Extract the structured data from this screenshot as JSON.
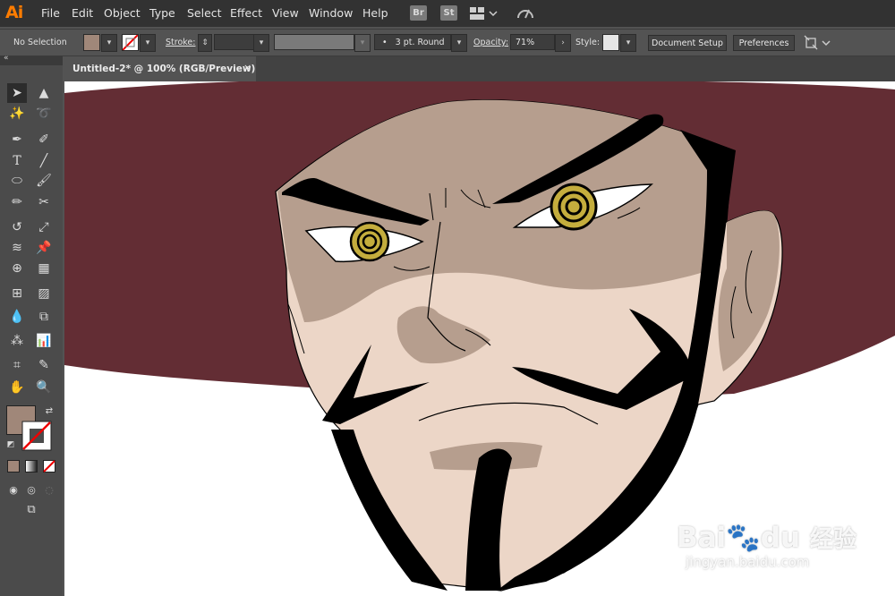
{
  "app": {
    "logo": "Ai"
  },
  "menu": {
    "items": [
      "File",
      "Edit",
      "Object",
      "Type",
      "Select",
      "Effect",
      "View",
      "Window",
      "Help"
    ]
  },
  "menubar_icons": {
    "bridge": "Br",
    "stock": "St"
  },
  "options_bar": {
    "selection_status": "No Selection",
    "fill_color": "#a08779",
    "stroke_label": "Stroke:",
    "brush_label": "3 pt. Round",
    "opacity_label": "Opacity:",
    "opacity_value": "71%",
    "style_label": "Style:",
    "document_setup_label": "Document Setup",
    "preferences_label": "Preferences"
  },
  "document_tab": {
    "title": "Untitled-2* @ 100% (RGB/Preview)",
    "close": "×"
  },
  "tools_panel": {
    "collapse_glyph": "«",
    "fill_color": "#a08779"
  },
  "canvas": {
    "hat_color": "#632d34",
    "skin_shadow": "#b69e8e",
    "skin_light": "#ecd6c7",
    "eye_color": "#c4ad3d",
    "line_color": "#000000"
  },
  "watermark": {
    "brand": "Bai",
    "brand2": "du",
    "cn": "经验",
    "url": "jingyan.baidu.com"
  }
}
